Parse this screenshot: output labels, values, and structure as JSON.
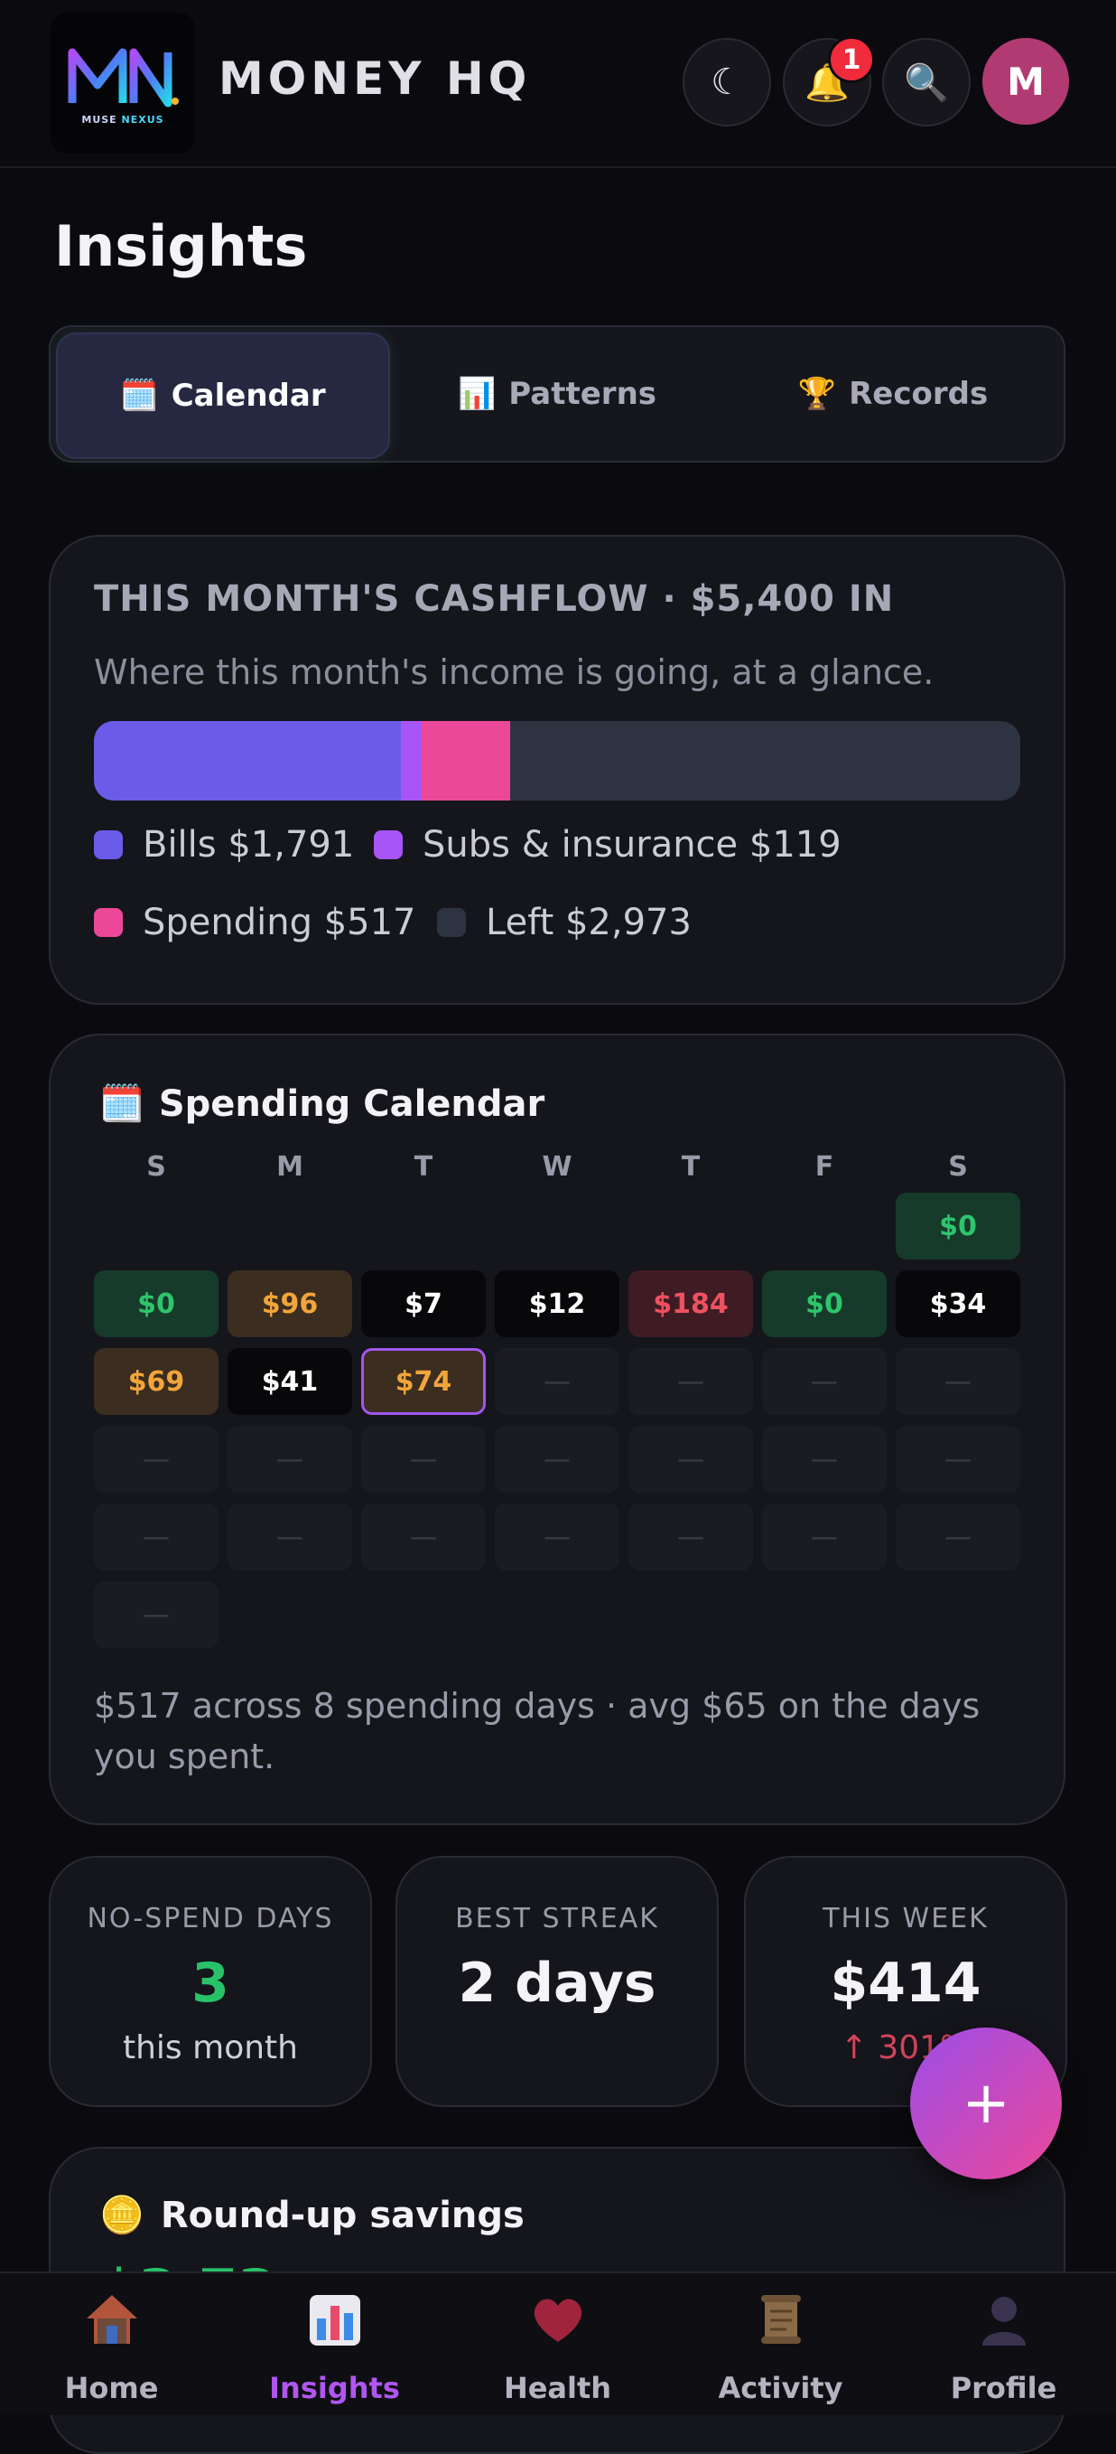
{
  "app": {
    "title": "MONEY HQ",
    "logo_sub_a": "MUSE",
    "logo_sub_b": "NEXUS",
    "notification_count": "1",
    "avatar_letter": "M",
    "theme_icon": "☾",
    "bell_icon": "🔔",
    "search_icon": "🔍"
  },
  "page": {
    "title": "Insights"
  },
  "tabs": [
    {
      "icon": "🗓️",
      "label": "Calendar",
      "active": true
    },
    {
      "icon": "📊",
      "label": "Patterns",
      "active": false
    },
    {
      "icon": "🏆",
      "label": "Records",
      "active": false
    }
  ],
  "cashflow": {
    "title": "THIS MONTH'S CASHFLOW · $5,400 IN",
    "subtitle": "Where this month's income is going, at a glance.",
    "segments": [
      {
        "name": "Bills",
        "label": "Bills $1,791",
        "amount": 1791,
        "color": "#6a5ce9"
      },
      {
        "name": "Subs & insurance",
        "label": "Subs & insurance $119",
        "amount": 119,
        "color": "#a855f7"
      },
      {
        "name": "Spending",
        "label": "Spending $517",
        "amount": 517,
        "color": "#ec4899"
      },
      {
        "name": "Left",
        "label": "Left $2,973",
        "amount": 2973,
        "color": "#2d3340"
      }
    ]
  },
  "calendar": {
    "icon": "🗓️",
    "title": "Spending Calendar",
    "weekdays": [
      "S",
      "M",
      "T",
      "W",
      "T",
      "F",
      "S"
    ],
    "empty_mark": "—",
    "days": [
      {
        "day": 1,
        "text": "$0",
        "tone": "zero"
      },
      {
        "day": 2,
        "text": "$0",
        "tone": "zero"
      },
      {
        "day": 3,
        "text": "$96",
        "tone": "mid"
      },
      {
        "day": 4,
        "text": "$7",
        "tone": "low"
      },
      {
        "day": 5,
        "text": "$12",
        "tone": "low"
      },
      {
        "day": 6,
        "text": "$184",
        "tone": "high"
      },
      {
        "day": 7,
        "text": "$0",
        "tone": "zero"
      },
      {
        "day": 8,
        "text": "$34",
        "tone": "low"
      },
      {
        "day": 9,
        "text": "$69",
        "tone": "mid"
      },
      {
        "day": 10,
        "text": "$41",
        "tone": "low"
      },
      {
        "day": 11,
        "text": "$74",
        "tone": "mid",
        "today": true
      },
      {
        "day": 12,
        "text": "—",
        "tone": "empty"
      },
      {
        "day": 13,
        "text": "—",
        "tone": "empty"
      },
      {
        "day": 14,
        "text": "—",
        "tone": "empty"
      },
      {
        "day": 15,
        "text": "—",
        "tone": "empty"
      },
      {
        "day": 16,
        "text": "—",
        "tone": "empty"
      },
      {
        "day": 17,
        "text": "—",
        "tone": "empty"
      },
      {
        "day": 18,
        "text": "—",
        "tone": "empty"
      },
      {
        "day": 19,
        "text": "—",
        "tone": "empty"
      },
      {
        "day": 20,
        "text": "—",
        "tone": "empty"
      },
      {
        "day": 21,
        "text": "—",
        "tone": "empty"
      },
      {
        "day": 22,
        "text": "—",
        "tone": "empty"
      },
      {
        "day": 23,
        "text": "—",
        "tone": "empty"
      },
      {
        "day": 24,
        "text": "—",
        "tone": "empty"
      },
      {
        "day": 25,
        "text": "—",
        "tone": "empty"
      },
      {
        "day": 26,
        "text": "—",
        "tone": "empty"
      },
      {
        "day": 27,
        "text": "—",
        "tone": "empty"
      },
      {
        "day": 28,
        "text": "—",
        "tone": "empty"
      },
      {
        "day": 29,
        "text": "—",
        "tone": "empty"
      },
      {
        "day": 30,
        "text": "—",
        "tone": "empty"
      }
    ],
    "summary": "$517 across 8 spending days · avg $65 on the days you spent."
  },
  "stats": [
    {
      "label": "NO-SPEND DAYS",
      "value": "3",
      "sub": "this month",
      "value_color": "#28c268",
      "sub_color": "#cfd0d8"
    },
    {
      "label": "BEST STREAK",
      "value": "2 days",
      "sub": "",
      "value_color": "#f4f4f8",
      "sub_color": "#cfd0d8"
    },
    {
      "label": "THIS WEEK",
      "value": "$414",
      "sub": "↑ 301%",
      "value_color": "#f4f4f8",
      "sub_color": "#d2455a"
    }
  ],
  "fab": {
    "label": "+"
  },
  "roundup": {
    "icon": "🪙",
    "title": "Round-up savings",
    "value": "$3.73"
  },
  "nav": [
    {
      "icon": "🏠",
      "label": "Home",
      "active": false
    },
    {
      "icon": "📊",
      "label": "Insights",
      "active": true
    },
    {
      "icon": "❤️",
      "label": "Health",
      "active": false
    },
    {
      "icon": "📜",
      "label": "Activity",
      "active": false
    },
    {
      "icon": "👤",
      "label": "Profile",
      "active": false
    }
  ]
}
